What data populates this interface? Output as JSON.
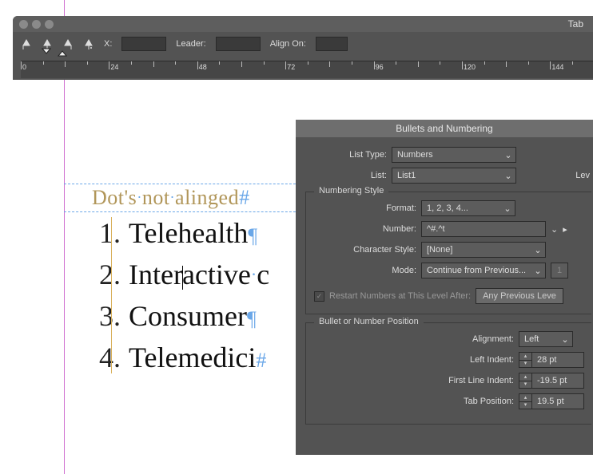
{
  "tabs_panel": {
    "title": "Tab",
    "fields": {
      "x_label": "X:",
      "leader_label": "Leader:",
      "alignon_label": "Align On:"
    },
    "ruler_numbers": [
      "0",
      "24",
      "48",
      "72",
      "96",
      "120",
      "144"
    ]
  },
  "doc": {
    "heading_words": [
      "Dot's",
      "not",
      "alinged"
    ],
    "items": [
      {
        "num": "1.",
        "text": "Telehealth",
        "eol": "¶"
      },
      {
        "num": "2.",
        "text_pre": "Inter",
        "text_post": "active",
        "trail_dot": true,
        "trail_letter": "c"
      },
      {
        "num": "3.",
        "text": "Consumer",
        "eol": "¶"
      },
      {
        "num": "4.",
        "text": "Telemedici",
        "eol": "#"
      }
    ]
  },
  "bn_panel": {
    "title": "Bullets and Numbering",
    "list_type": {
      "label": "List Type:",
      "value": "Numbers"
    },
    "list": {
      "label": "List:",
      "value": "List1"
    },
    "level_label": "Lev",
    "numbering": {
      "title": "Numbering Style",
      "format": {
        "label": "Format:",
        "value": "1, 2, 3, 4..."
      },
      "number": {
        "label": "Number:",
        "value": "^#.^t"
      },
      "charstyle": {
        "label": "Character Style:",
        "value": "[None]"
      },
      "mode": {
        "label": "Mode:",
        "value": "Continue from Previous...",
        "at": "1"
      },
      "restart": {
        "label": "Restart Numbers at This Level After:",
        "value": "Any Previous Leve"
      }
    },
    "position": {
      "title": "Bullet or Number Position",
      "alignment": {
        "label": "Alignment:",
        "value": "Left"
      },
      "left_indent": {
        "label": "Left Indent:",
        "value": "28 pt"
      },
      "first_line": {
        "label": "First Line Indent:",
        "value": "-19.5 pt"
      },
      "tab_pos": {
        "label": "Tab Position:",
        "value": "19.5 pt"
      }
    }
  }
}
